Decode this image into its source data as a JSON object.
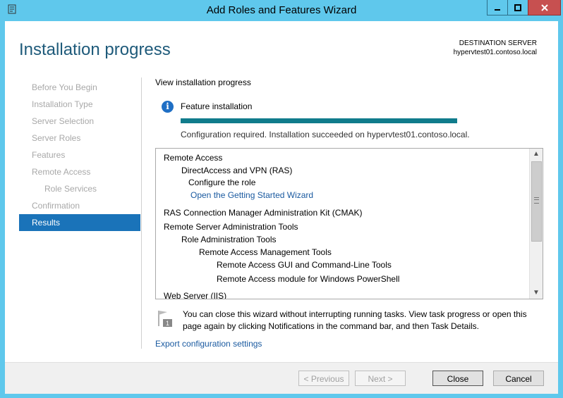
{
  "window": {
    "title": "Add Roles and Features Wizard",
    "app_icon": "server-manager-icon",
    "controls": {
      "minimize": "minimize-icon",
      "maximize": "maximize-icon",
      "close": "close-icon"
    }
  },
  "header": {
    "page_title": "Installation progress",
    "destination_label": "DESTINATION SERVER",
    "destination_server": "hypervtest01.contoso.local"
  },
  "nav": {
    "items": [
      {
        "label": "Before You Begin",
        "state": "disabled"
      },
      {
        "label": "Installation Type",
        "state": "disabled"
      },
      {
        "label": "Server Selection",
        "state": "disabled"
      },
      {
        "label": "Server Roles",
        "state": "disabled"
      },
      {
        "label": "Features",
        "state": "disabled"
      },
      {
        "label": "Remote Access",
        "state": "disabled"
      },
      {
        "label": "Role Services",
        "state": "disabled"
      },
      {
        "label": "Confirmation",
        "state": "disabled"
      },
      {
        "label": "Results",
        "state": "active"
      }
    ]
  },
  "main": {
    "section_heading": "View installation progress",
    "feature_label": "Feature installation",
    "progress": 1.0,
    "status_text": "Configuration required. Installation succeeded on hypervtest01.contoso.local.",
    "results": [
      "Remote Access",
      "DirectAccess and VPN (RAS)",
      "Configure the role",
      "Open the Getting Started Wizard",
      "RAS Connection Manager Administration Kit (CMAK)",
      "Remote Server Administration Tools",
      "Role Administration Tools",
      "Remote Access Management Tools",
      "Remote Access GUI and Command-Line Tools",
      "Remote Access module for Windows PowerShell",
      "Web Server (IIS)"
    ],
    "note": "You can close this wizard without interrupting running tasks. View task progress or open this page again by clicking Notifications in the command bar, and then Task Details.",
    "export_link": "Export configuration settings"
  },
  "footer": {
    "previous": "< Previous",
    "next": "Next >",
    "close": "Close",
    "cancel": "Cancel"
  },
  "colors": {
    "titlebar": "#5fc8ec",
    "accent": "#1a73b9",
    "progress": "#107c8c",
    "link": "#1a5aa0",
    "title": "#1e5a7a"
  }
}
